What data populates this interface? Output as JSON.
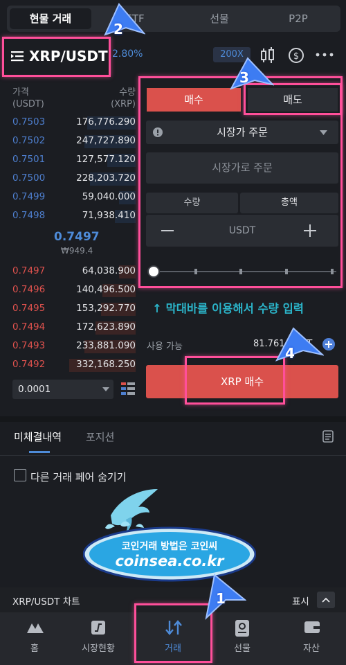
{
  "top_tabs": [
    "현물 거래",
    "ETF",
    "선물",
    "P2P"
  ],
  "header": {
    "pair": "XRP/USDT",
    "change": "2.80%",
    "leverage": "200X"
  },
  "orderbook": {
    "price_header": "가격\n(USDT)",
    "qty_header": "수량\n(XRP)",
    "asks": [
      {
        "price": "0.7503",
        "qty": "176,776.290",
        "depth": 0.58
      },
      {
        "price": "0.7502",
        "qty": "247,727.890",
        "depth": 0.62
      },
      {
        "price": "0.7501",
        "qty": "127,577.120",
        "depth": 0.34
      },
      {
        "price": "0.7500",
        "qty": "228,203.720",
        "depth": 0.55
      },
      {
        "price": "0.7499",
        "qty": "59,040.000",
        "depth": 0.2
      },
      {
        "price": "0.7498",
        "qty": "71,938.410",
        "depth": 0.25
      }
    ],
    "mid_price": "0.7497",
    "mid_krw": "₩949.4",
    "bids": [
      {
        "price": "0.7497",
        "qty": "64,038.900",
        "depth": 0.2
      },
      {
        "price": "0.7496",
        "qty": "140,496.500",
        "depth": 0.4
      },
      {
        "price": "0.7495",
        "qty": "153,292.770",
        "depth": 0.42
      },
      {
        "price": "0.7494",
        "qty": "172,623.890",
        "depth": 0.48
      },
      {
        "price": "0.7493",
        "qty": "233,881.090",
        "depth": 0.62
      },
      {
        "price": "0.7492",
        "qty": "332,168.250",
        "depth": 0.8
      }
    ],
    "step": "0.0001"
  },
  "order_form": {
    "buy_tab": "매수",
    "sell_tab": "매도",
    "order_type": "시장가 주문",
    "market_price_placeholder": "시장가로 주문",
    "qty_tab": "수량",
    "total_tab": "총액",
    "unit": "USDT",
    "slider_hint": "↑ 막대바를 이용해서 수량 입력",
    "available_label": "사용 가능",
    "available_value": "81.761 USDT",
    "buy_button": "XRP 매수"
  },
  "bottom_tabs": {
    "open_orders": "미체결내역",
    "positions": "포지션",
    "hide_other_pairs": "다른 거래 페어 숨기기"
  },
  "chart_bar": {
    "label": "XRP/USDT 차트",
    "show": "표시"
  },
  "bottom_nav": [
    "홈",
    "시장현황",
    "거래",
    "선물",
    "자산"
  ],
  "watermark": {
    "line1": "코인거래 방법은 코인씨",
    "line2": "coinsea.co.kr"
  },
  "callouts": [
    "1",
    "2",
    "3",
    "4"
  ],
  "colors": {
    "buy": "#da514c",
    "accent_blue": "#4e8bd8",
    "highlight": "#ff4f9a",
    "hint": "#2bb3c8"
  }
}
